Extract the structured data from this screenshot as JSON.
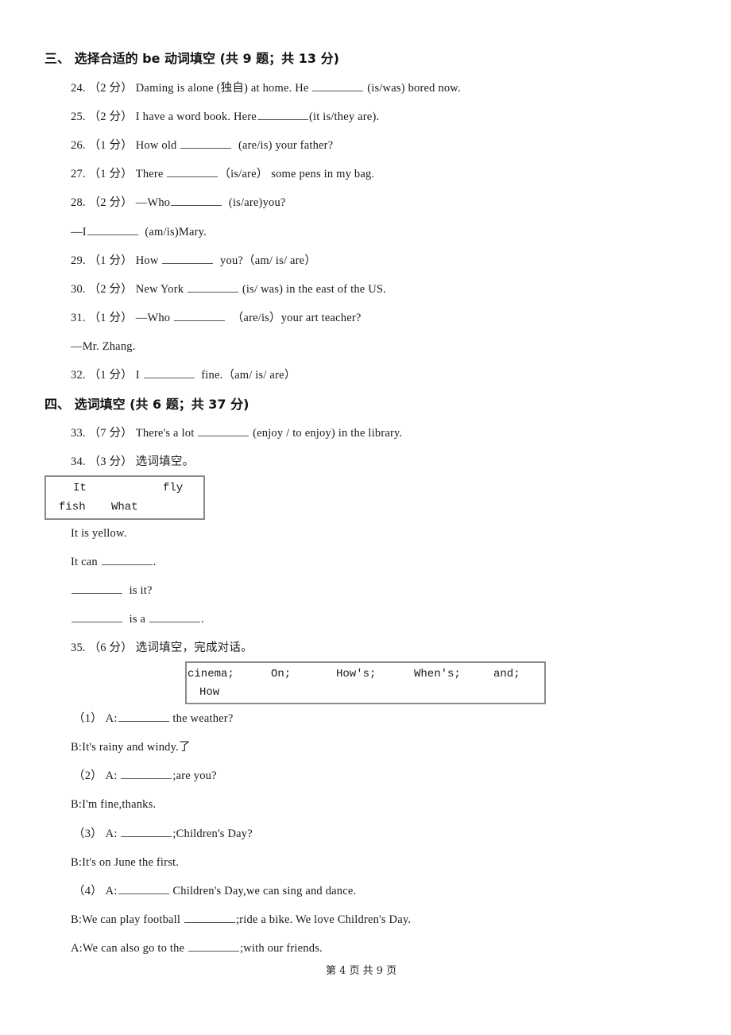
{
  "section3": {
    "heading": "三、 选择合适的 be 动词填空 (共 9 题；共 13 分)",
    "questions": [
      {
        "num": "24.",
        "score": "（2 分）",
        "pre": "Daming is alone (独自) at home. He ",
        "post": " (is/was) bored now."
      },
      {
        "num": "25.",
        "score": "（2 分）",
        "pre": "I have a word book. Here",
        "post": "(it is/they are)."
      },
      {
        "num": "26.",
        "score": "（1 分）",
        "pre": "How old ",
        "post": "  (are/is) your father?"
      },
      {
        "num": "27.",
        "score": "（1 分）",
        "pre": "There ",
        "post": "（is/are） some pens in my bag."
      },
      {
        "num": "28.",
        "score": "（2 分）",
        "pre": "—Who",
        "post": "  (is/are)you?",
        "answer_pre": "—I",
        "answer_post": "  (am/is)Mary."
      },
      {
        "num": "29.",
        "score": "（1 分）",
        "pre": "How ",
        "post": "  you?（am/ is/ are）"
      },
      {
        "num": "30.",
        "score": "（2 分）",
        "pre": "New York ",
        "post": " (is/ was) in the east of the US."
      },
      {
        "num": "31.",
        "score": "（1 分）",
        "pre": "—Who ",
        "post": "  （are/is）your art teacher?",
        "answer": "—Mr. Zhang."
      },
      {
        "num": "32.",
        "score": "（1 分）",
        "pre": "I ",
        "post": "  fine.（am/ is/ are）"
      }
    ]
  },
  "section4": {
    "heading": "四、 选词填空 (共 6 题；共 37 分)",
    "q33": {
      "num": "33.",
      "score": "（7 分）",
      "pre": "There's a lot ",
      "post": " (enjoy / to enjoy) in the library."
    },
    "q34": {
      "num": "34.",
      "score": "（3 分）",
      "instruction": "选词填空。",
      "word_box": [
        "It",
        "fly",
        "fish",
        "What"
      ],
      "lines": [
        {
          "pre": "It is yellow."
        },
        {
          "pre": "It can ",
          "post": "."
        },
        {
          "post": "  is it?"
        },
        {
          "post": "  is a ",
          "post2": "."
        }
      ]
    },
    "q35": {
      "num": "35.",
      "score": "（6 分）",
      "instruction": "选词填空，完成对话。",
      "word_box": [
        "cinema;",
        "On;",
        "How's;",
        "When's;",
        "and;",
        "How"
      ],
      "dialog": [
        {
          "label": "（1） A:",
          "post": " the weather?"
        },
        {
          "text": "B:It's rainy and windy.了"
        },
        {
          "label": "（2） A: ",
          "post": ";are you?"
        },
        {
          "text": "B:I'm fine,thanks."
        },
        {
          "label": "（3） A: ",
          "post": ";Children's Day?"
        },
        {
          "text": "B:It's on June the first."
        },
        {
          "label": "（4） A:",
          "post": " Children's Day,we can sing and dance."
        },
        {
          "pre": "B:We can play football ",
          "post": ";ride a bike. We love Children's Day."
        },
        {
          "pre": "A:We can also go to the ",
          "post": ";with our friends."
        }
      ]
    }
  },
  "footer": {
    "page_text": "第 4 页 共 9 页"
  }
}
